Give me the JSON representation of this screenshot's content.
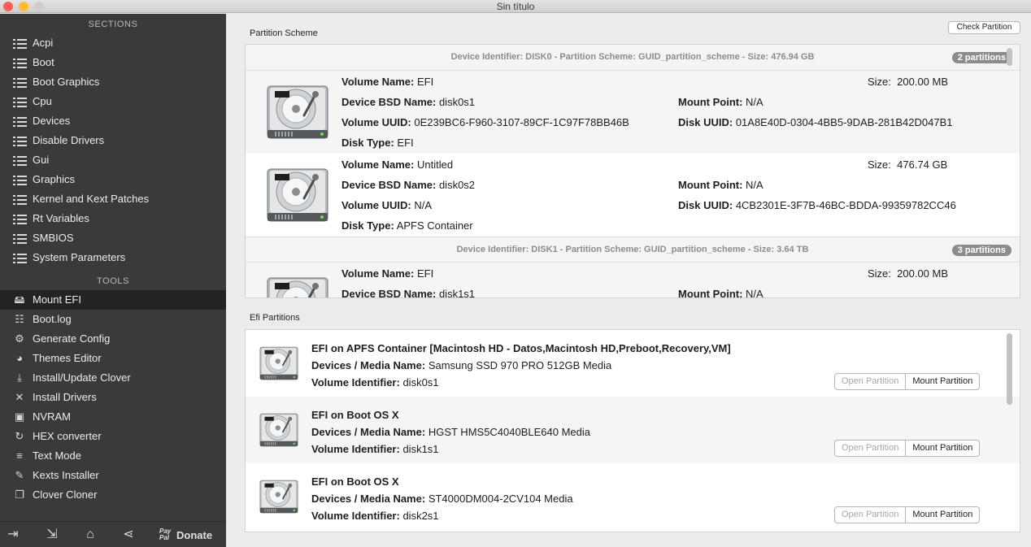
{
  "window": {
    "title": "Sin título"
  },
  "sidebar": {
    "sections_header": "SECTIONS",
    "sections": [
      {
        "label": "Acpi",
        "icon": "list-icon"
      },
      {
        "label": "Boot",
        "icon": "list-icon"
      },
      {
        "label": "Boot Graphics",
        "icon": "list-icon"
      },
      {
        "label": "Cpu",
        "icon": "list-icon"
      },
      {
        "label": "Devices",
        "icon": "list-icon"
      },
      {
        "label": "Disable Drivers",
        "icon": "list-icon"
      },
      {
        "label": "Gui",
        "icon": "list-icon"
      },
      {
        "label": "Graphics",
        "icon": "list-icon"
      },
      {
        "label": "Kernel and Kext Patches",
        "icon": "list-icon"
      },
      {
        "label": "Rt Variables",
        "icon": "list-icon"
      },
      {
        "label": "SMBIOS",
        "icon": "list-icon"
      },
      {
        "label": "System Parameters",
        "icon": "list-icon"
      }
    ],
    "tools_header": "TOOLS",
    "tools": [
      {
        "label": "Mount EFI",
        "icon": "disk-icon",
        "selected": true
      },
      {
        "label": "Boot.log",
        "icon": "log-search-icon"
      },
      {
        "label": "Generate Config",
        "icon": "gears-icon"
      },
      {
        "label": "Themes Editor",
        "icon": "palette-icon"
      },
      {
        "label": "Install/Update Clover",
        "icon": "download-icon"
      },
      {
        "label": "Install Drivers",
        "icon": "tools-icon"
      },
      {
        "label": "NVRAM",
        "icon": "chip-icon"
      },
      {
        "label": "HEX converter",
        "icon": "convert-icon"
      },
      {
        "label": "Text Mode",
        "icon": "text-icon"
      },
      {
        "label": "Kexts Installer",
        "icon": "plug-icon"
      },
      {
        "label": "Clover Cloner",
        "icon": "clone-icon"
      }
    ],
    "footer": {
      "icons": [
        "import-icon",
        "export-icon",
        "home-icon",
        "share-icon"
      ],
      "paypal_text": "Pay Pal",
      "donate_label": "Donate"
    }
  },
  "main": {
    "check_partition_label": "Check Partition",
    "partition_scheme_label": "Partition Scheme",
    "disks": [
      {
        "header": "Device Identifier: DISK0 - Partition Scheme: GUID_partition_scheme - Size: 476.94 GB",
        "badge": "2 partitions",
        "volumes": [
          {
            "volume_name": "EFI",
            "size": "200.00 MB",
            "bsd_name": "disk0s1",
            "mount_point": "N/A",
            "volume_uuid": "0E239BC6-F960-3107-89CF-1C97F78BB46B",
            "disk_uuid": "01A8E40D-0304-4BB5-9DAB-281B42D047B1",
            "disk_type": "EFI"
          },
          {
            "volume_name": "Untitled",
            "size": "476.74 GB",
            "bsd_name": "disk0s2",
            "mount_point": "N/A",
            "volume_uuid": "N/A",
            "disk_uuid": "4CB2301E-3F7B-46BC-BDDA-99359782CC46",
            "disk_type": "APFS Container"
          }
        ]
      },
      {
        "header": "Device Identifier: DISK1 - Partition Scheme: GUID_partition_scheme - Size: 3.64 TB",
        "badge": "3 partitions",
        "volumes": [
          {
            "volume_name": "EFI",
            "size": "200.00 MB",
            "bsd_name": "disk1s1",
            "mount_point": "N/A"
          }
        ]
      }
    ],
    "labels": {
      "volume_name": "Volume Name:",
      "size": "Size:",
      "bsd_name": "Device BSD Name:",
      "mount_point": "Mount Point:",
      "volume_uuid": "Volume UUID:",
      "disk_uuid": "Disk UUID:",
      "disk_type": "Disk Type:",
      "media_name": "Devices / Media Name:",
      "volume_identifier": "Volume Identifier:"
    },
    "efi_partitions_label": "Efi Partitions",
    "efi_partitions": [
      {
        "title": "EFI on APFS Container [Macintosh HD - Datos,Macintosh HD,Preboot,Recovery,VM]",
        "media_name": "Samsung SSD 970 PRO 512GB Media",
        "volume_identifier": "disk0s1"
      },
      {
        "title": "EFI on Boot OS X",
        "media_name": "HGST HMS5C4040BLE640 Media",
        "volume_identifier": "disk1s1"
      },
      {
        "title": "EFI on Boot OS X",
        "media_name": "ST4000DM004-2CV104 Media",
        "volume_identifier": "disk2s1"
      }
    ],
    "open_partition_label": "Open Partition",
    "mount_partition_label": "Mount Partition"
  }
}
